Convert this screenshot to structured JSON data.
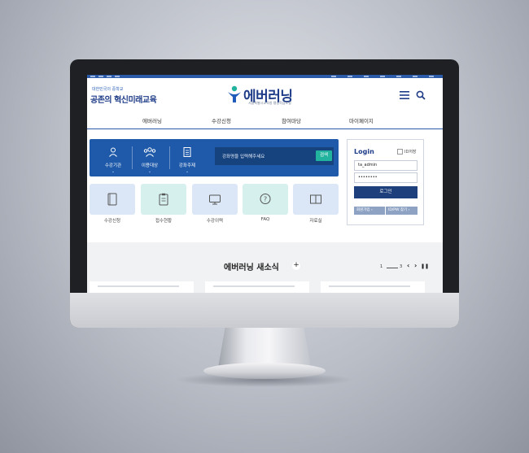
{
  "header": {
    "slogan_small": "대한민국의 중학교",
    "slogan_big": "공존의 혁신미래교육",
    "logo_text": "에버러닝",
    "logo_subtitle": "서울특별시교육청 평생학습포털"
  },
  "nav": {
    "items": [
      {
        "label": "에버러닝"
      },
      {
        "label": "수강신청"
      },
      {
        "label": "참여마당"
      },
      {
        "label": "마이페이지"
      }
    ]
  },
  "search_panel": {
    "categories": [
      {
        "label": "수강기관",
        "icon": "person-icon"
      },
      {
        "label": "이용대상",
        "icon": "group-icon"
      },
      {
        "label": "강좌주제",
        "icon": "document-icon"
      }
    ],
    "placeholder": "강좌명을 입력해주세요",
    "button": "검색"
  },
  "quick_links": [
    {
      "label": "수강신청",
      "icon": "book-icon",
      "color": "#dbe7f7"
    },
    {
      "label": "접수현황",
      "icon": "clipboard-icon",
      "color": "#d6f0ee"
    },
    {
      "label": "수강이력",
      "icon": "monitor-icon",
      "color": "#dbe7f7"
    },
    {
      "label": "FAQ",
      "icon": "question-chat-icon",
      "color": "#d6f0ee"
    },
    {
      "label": "자료실",
      "icon": "open-book-icon",
      "color": "#dbe7f7"
    }
  ],
  "login": {
    "title": "Login",
    "id_save": "ID저장",
    "username": "ta_admin",
    "password": "••••••••",
    "button": "로그인",
    "join": "회원가입",
    "find": "ID/PW 찾기"
  },
  "news": {
    "title": "에버러닝 새소식",
    "plus": "+",
    "page_current": "1",
    "page_total": "3"
  },
  "colors": {
    "brand_blue": "#1e5aa9",
    "teal": "#22b39f",
    "navy": "#1d3f7c"
  }
}
